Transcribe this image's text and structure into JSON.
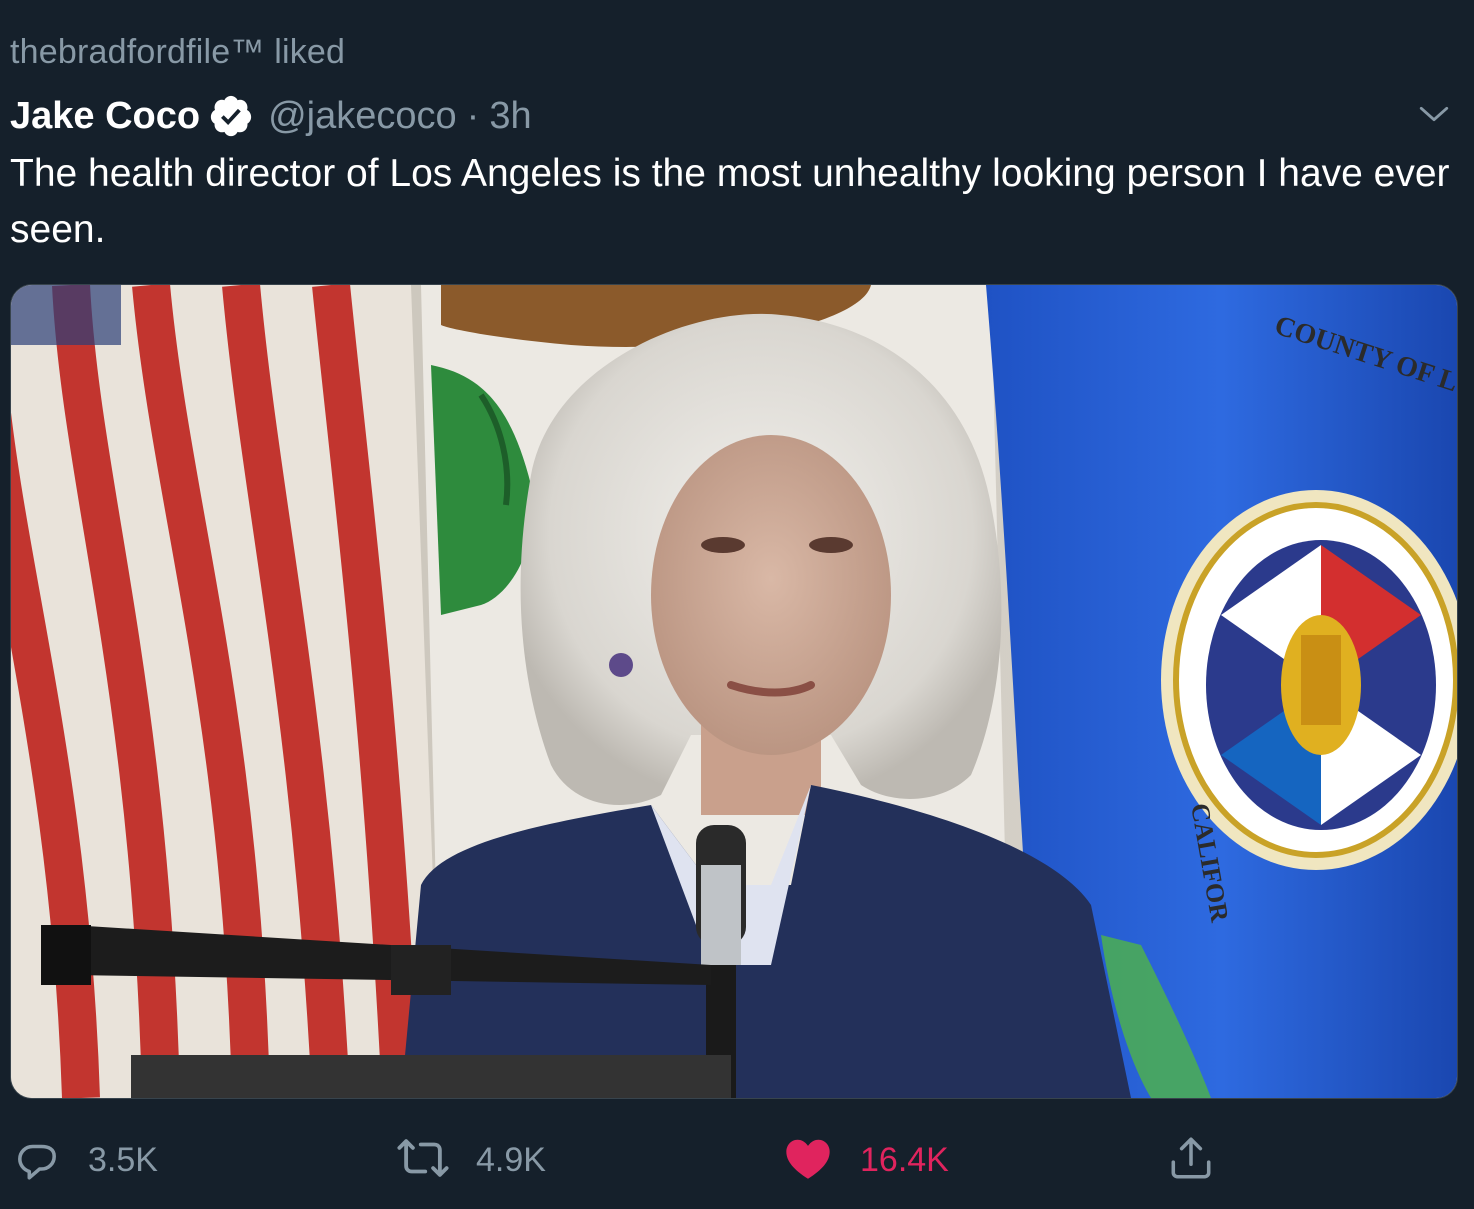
{
  "context": {
    "text": "thebradfordfile™ liked"
  },
  "author": {
    "display_name": "Jake Coco",
    "handle": "@jakecoco",
    "separator": "·",
    "time": "3h"
  },
  "tweet": {
    "text": "The health director of Los Angeles is the most unhealthy looking person I have ever seen."
  },
  "media": {
    "seal_text_top": "COUNTY OF LOS ANGELES",
    "seal_text_left": "CALIFOR"
  },
  "actions": {
    "reply_count": "3.5K",
    "retweet_count": "4.9K",
    "like_count": "16.4K"
  },
  "colors": {
    "background": "#15202b",
    "secondary_text": "#8899a6",
    "like": "#e0245e",
    "accent": "#1da1f2"
  },
  "icons": {
    "verified": "verified-badge-icon",
    "caret": "chevron-down-icon",
    "reply": "reply-icon",
    "retweet": "retweet-icon",
    "like": "heart-icon",
    "share": "share-icon"
  }
}
